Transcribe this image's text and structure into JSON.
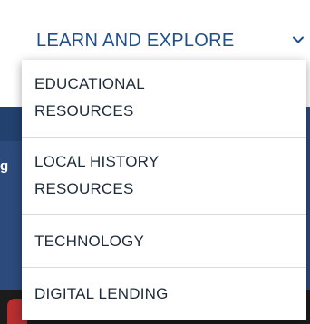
{
  "nav": {
    "trigger_label": "LEARN AND EXPLORE",
    "chevron_icon": "chevron-down-icon",
    "text_color": "#1f4e8c"
  },
  "dropdown": {
    "items": [
      {
        "label": "EDUCATIONAL\nRESOURCES"
      },
      {
        "label": "LOCAL HISTORY\nRESOURCES"
      },
      {
        "label": "TECHNOLOGY"
      },
      {
        "label": "DIGITAL LENDING"
      }
    ]
  },
  "background": {
    "partial_glyph": "g",
    "band_color": "#2c4a7c"
  }
}
